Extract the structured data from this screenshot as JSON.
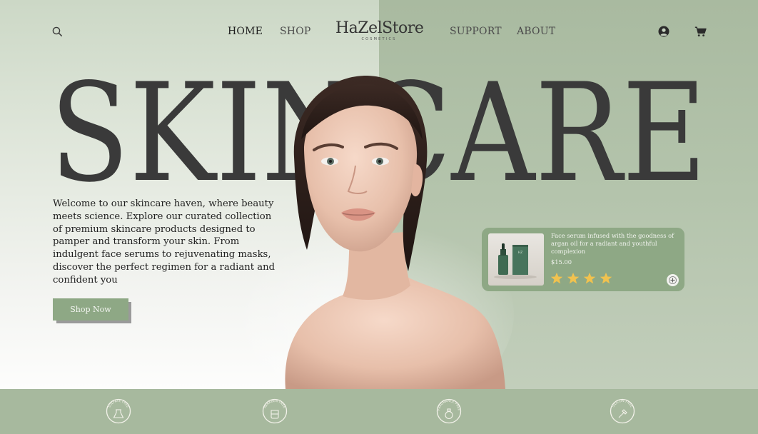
{
  "brand": {
    "name": "HaZelStore",
    "tagline": "COSMETICS"
  },
  "nav": {
    "home": "HOME",
    "shop": "SHOP",
    "support": "SUPPORT",
    "about": "ABOUT",
    "icons": [
      "search-icon",
      "user-icon",
      "cart-icon"
    ]
  },
  "hero": {
    "headline": "SKINCARE",
    "intro": "Welcome to our skincare haven, where beauty meets science. Explore our curated collection of premium skincare products designed to pamper and transform your skin. From indulgent face serums to rejuvenating masks, discover the perfect regimen for a radiant and confident you",
    "cta_label": "Shop Now"
  },
  "product": {
    "description": "Face serum infused with the goodness of argan oil for a radiant and youthful complexion",
    "price": "$15.00",
    "rating": 4,
    "box_label": "HZ"
  },
  "badges": [
    {
      "label": "SULFATE FREE",
      "icon": "flask-icon"
    },
    {
      "label": "PARABEN FREE",
      "icon": "beaker-icon"
    },
    {
      "label": "FRAGRANCE FREE",
      "icon": "perfume-icon"
    },
    {
      "label": "SILICON FREE",
      "icon": "dropper-icon"
    }
  ],
  "colors": {
    "accent": "#8ea885",
    "left_bg": "#ccd8c6",
    "right_bg": "#a9baa0",
    "footer_bg": "#a7b99e",
    "star": "#f0c24f",
    "text": "#2f2f2f"
  }
}
